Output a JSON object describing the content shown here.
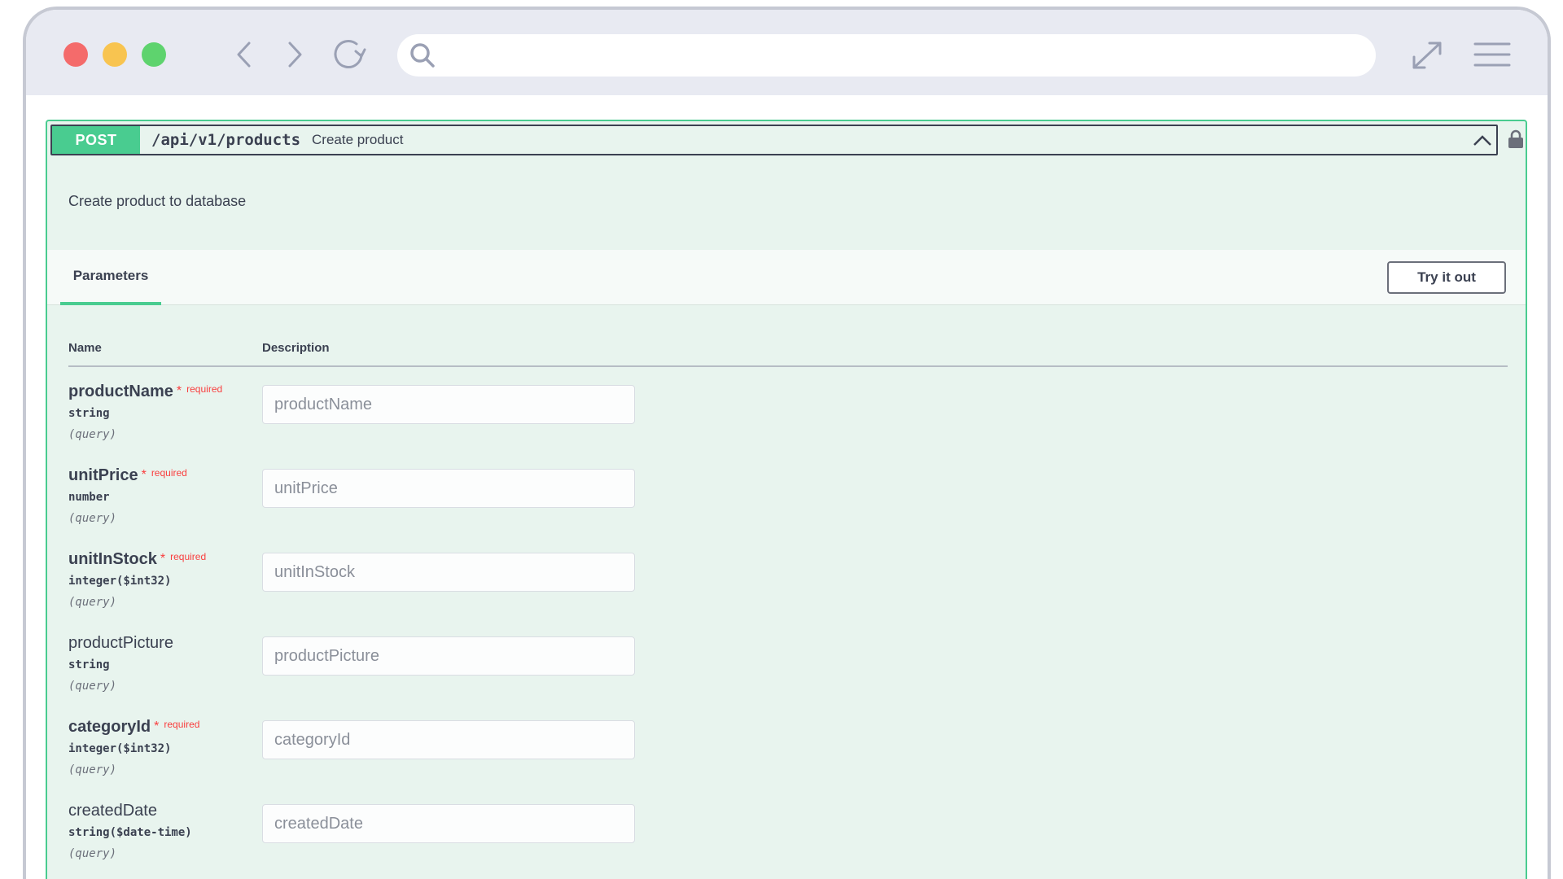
{
  "browser": {
    "search": {
      "value": "",
      "placeholder": ""
    }
  },
  "operation": {
    "method": "POST",
    "path": "/api/v1/products",
    "summary": "Create product",
    "description": "Create product to database"
  },
  "parameters_section": {
    "tab_label": "Parameters",
    "try_button": "Try it out",
    "col_name": "Name",
    "col_description": "Description"
  },
  "params": [
    {
      "name": "productName",
      "required": true,
      "star": "*",
      "required_label": "required",
      "type": "string",
      "in": "(query)",
      "placeholder": "productName"
    },
    {
      "name": "unitPrice",
      "required": true,
      "star": "*",
      "required_label": "required",
      "type": "number",
      "in": "(query)",
      "placeholder": "unitPrice"
    },
    {
      "name": "unitInStock",
      "required": true,
      "star": "*",
      "required_label": "required",
      "type": "integer($int32)",
      "in": "(query)",
      "placeholder": "unitInStock"
    },
    {
      "name": "productPicture",
      "required": false,
      "type": "string",
      "in": "(query)",
      "placeholder": "productPicture"
    },
    {
      "name": "categoryId",
      "required": true,
      "star": "*",
      "required_label": "required",
      "type": "integer($int32)",
      "in": "(query)",
      "placeholder": "categoryId"
    },
    {
      "name": "createdDate",
      "required": false,
      "type": "string($date-time)",
      "in": "(query)",
      "placeholder": "createdDate"
    }
  ],
  "colors": {
    "post_accent": "#49cc90",
    "required_red": "#f93e3e",
    "block_bg": "#e8f4ee"
  },
  "icons": [
    "search-icon",
    "back-icon",
    "forward-icon",
    "reload-icon",
    "expand-icon",
    "menu-icon",
    "chevron-up-icon",
    "lock-icon"
  ]
}
